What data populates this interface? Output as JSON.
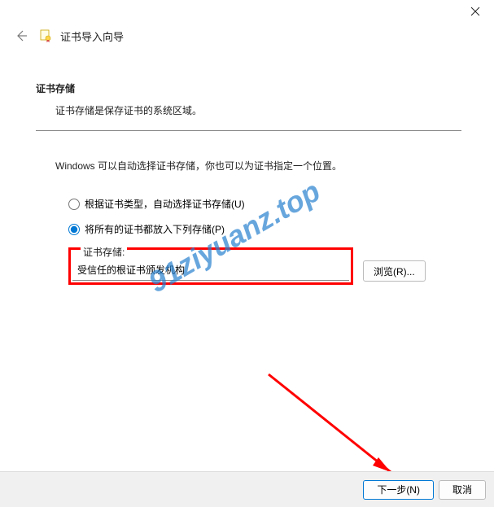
{
  "window": {
    "title": "证书导入向导"
  },
  "section": {
    "title": "证书存储",
    "description": "证书存储是保存证书的系统区域。"
  },
  "explain": "Windows 可以自动选择证书存储，你也可以为证书指定一个位置。",
  "radios": {
    "auto": "根据证书类型，自动选择证书存储(U)",
    "manual": "将所有的证书都放入下列存储(P)"
  },
  "store": {
    "legend": "证书存储:",
    "value": "受信任的根证书颁发机构"
  },
  "buttons": {
    "browse": "浏览(R)...",
    "next": "下一步(N)",
    "cancel": "取消"
  },
  "watermark": "91ziyuanz.top"
}
